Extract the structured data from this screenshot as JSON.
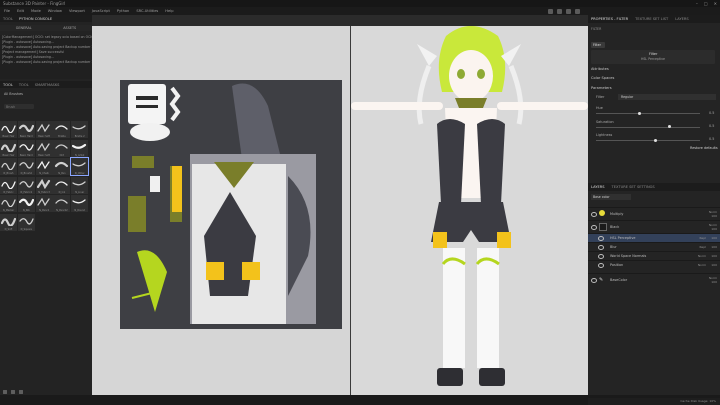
{
  "app": {
    "title": "Substance 3D Painter - FingGirl",
    "window_controls": [
      "–",
      "□",
      "✕"
    ]
  },
  "menu": [
    "File",
    "Edit",
    "Mode",
    "Window",
    "Viewport",
    "JavaScript",
    "Python",
    "SRC-Utilities",
    "Help"
  ],
  "left_panel": {
    "tabs": [
      "TOOL",
      "PYTHON CONSOLE"
    ],
    "active_tab": "PYTHON CONSOLE",
    "subtabs": [
      "GENERAL",
      "ASSETS"
    ],
    "log_lines": [
      "[ColorManagement] OCIO: set legacy ocio based on OCIO config",
      "[Plugin - autosave] Autosaving...",
      "[Plugin - autosave] Auto-saving project Backup number 1 ...",
      "[Project management] Save successful",
      "[Plugin - autosave] Autosaving...",
      "[Plugin - autosave] Auto-saving project Backup number 1 ..."
    ],
    "shelf_tabs": [
      "TOOL",
      "TOOL",
      "SMARTMASKS"
    ],
    "shelf_filter": "All Brushes",
    "search_placeholder": "Brush",
    "brushes": [
      {
        "label": "Basic Hair"
      },
      {
        "label": "Basic Hard"
      },
      {
        "label": "Basic Soft"
      },
      {
        "label": "Bristle"
      },
      {
        "label": "Bristle 2"
      },
      {
        "label": "Basic Hair"
      },
      {
        "label": "Basic Hard"
      },
      {
        "label": "Basic Soft"
      },
      {
        "label": "Dirt"
      },
      {
        "label": "N_Artist"
      },
      {
        "label": "N_Brush"
      },
      {
        "label": "N_Brush2"
      },
      {
        "label": "N_Chalk"
      },
      {
        "label": "N_Pen"
      },
      {
        "label": "N_Other"
      },
      {
        "label": "N_Fabric"
      },
      {
        "label": "N_Fabric2"
      },
      {
        "label": "N_Fabric3"
      },
      {
        "label": "N_Ink"
      },
      {
        "label": "N_Liner"
      },
      {
        "label": "N_Marker"
      },
      {
        "label": "N_Nib"
      },
      {
        "label": "N_Pencil"
      },
      {
        "label": "N_Pencil2"
      },
      {
        "label": "N_Round"
      },
      {
        "label": "N_Soft"
      },
      {
        "label": "N_Square"
      }
    ]
  },
  "viewports": {
    "left_dropdown": "Material",
    "left_channel": "Colours - sRGB",
    "right_dropdown": "Material",
    "right_channel": "Colours - sRGB"
  },
  "right_panel": {
    "tabs": [
      "PROPERTIES - FILTER",
      "TEXTURE SET LIST",
      "LAYERS"
    ],
    "active_tab": "PROPERTIES - FILTER",
    "section_label": "FILTER",
    "filter_button": "Filter",
    "filter_name": "Filter",
    "filter_sub": "HSL Perceptive",
    "sections": [
      "Attributes",
      "Color Spaces",
      "Parameters"
    ],
    "params": {
      "filter_label": "Filter",
      "filter_value": "Regular",
      "hue_label": "Hue",
      "hue_value": "0.5",
      "saturation_label": "Saturation",
      "saturation_value": "0.5",
      "lightness_label": "Lightness",
      "lightness_value": "0.5",
      "reset_label": "Restore defaults"
    },
    "layer_tabs": [
      "LAYERS",
      "TEXTURE SET SETTINGS"
    ],
    "blend_select": "Base color",
    "layers": [
      {
        "name": "Multiply",
        "blend": "Norm",
        "opacity": "100"
      },
      {
        "name": "Black",
        "blend": "Norm",
        "opacity": "100"
      },
      {
        "name": "HSL Perceptive",
        "blend": "Repl",
        "opacity": "100"
      },
      {
        "name": "Blur",
        "blend": "Repl",
        "opacity": "100"
      },
      {
        "name": "World Space Normals",
        "blend": "Norm",
        "opacity": "100"
      },
      {
        "name": "Position",
        "blend": "Norm",
        "opacity": "100"
      },
      {
        "name": "BaseColor",
        "blend": "Norm",
        "opacity": "100"
      }
    ],
    "status": "Cache Disk Usage: 10%"
  },
  "colors": {
    "accent_yellow": "#f3c21b",
    "accent_lime": "#b5d61f",
    "olive": "#7a7e2a",
    "suit_dark": "#3b3b42"
  }
}
